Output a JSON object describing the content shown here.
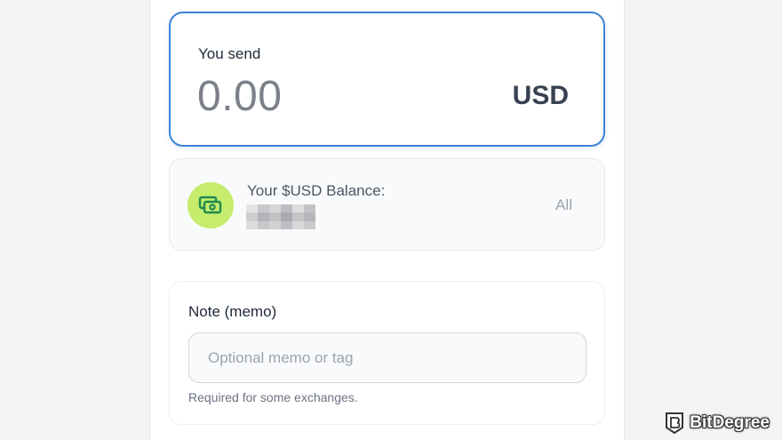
{
  "send": {
    "label": "You send",
    "amount": "0.00",
    "currency": "USD"
  },
  "balance": {
    "label": "Your $USD Balance:",
    "value_redacted": true,
    "all_label": "All",
    "icon": "cash-icon",
    "icon_bg": "#c5ec6c"
  },
  "memo": {
    "label": "Note (memo)",
    "value": "",
    "placeholder": "Optional memo or tag",
    "hint": "Required for some exchanges."
  },
  "watermark": {
    "text": "BitDegree",
    "icon": "bitdegree-logo-icon"
  },
  "colors": {
    "accent_border": "#3b82d6"
  }
}
